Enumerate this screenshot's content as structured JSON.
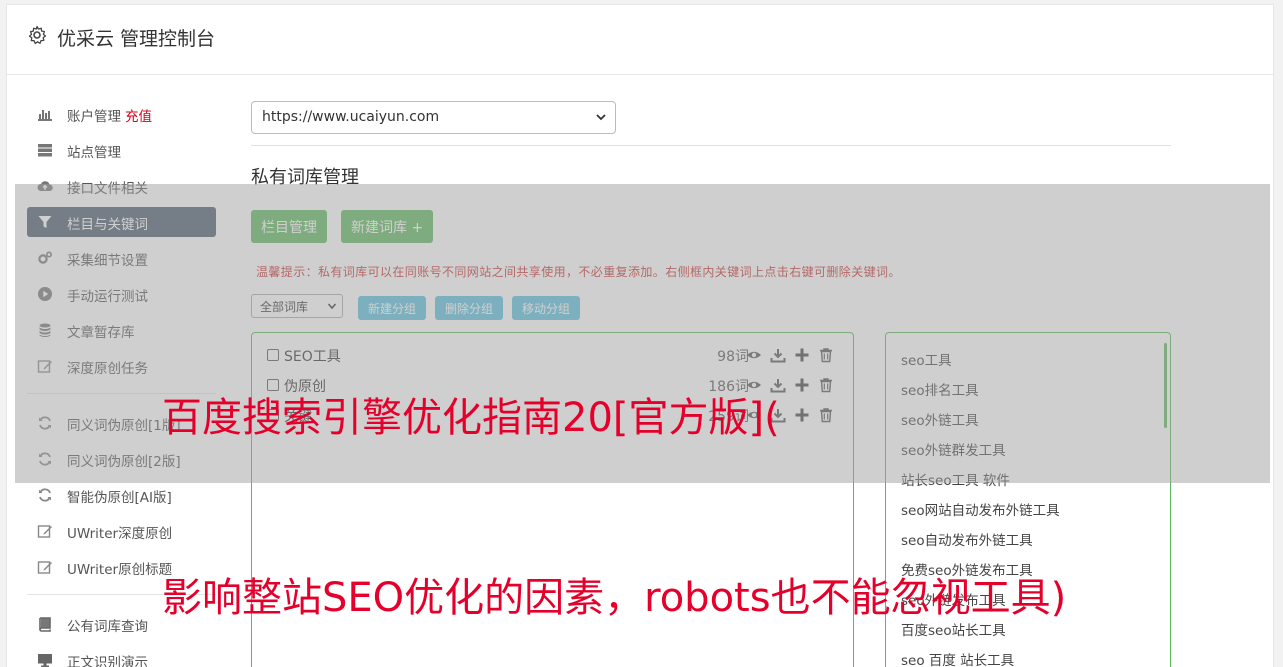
{
  "header": {
    "title": "优采云 管理控制台"
  },
  "sidebar": {
    "items": [
      {
        "label": "账户管理",
        "badge": "充值",
        "icon": "bar-chart-icon"
      },
      {
        "label": "站点管理",
        "icon": "server-icon"
      },
      {
        "label": "接口文件相关",
        "icon": "cloud-upload-icon"
      },
      {
        "label": "栏目与关键词",
        "icon": "filter-icon"
      },
      {
        "label": "采集细节设置",
        "icon": "cogs-icon"
      },
      {
        "label": "手动运行测试",
        "icon": "play-circle-icon"
      },
      {
        "label": "文章暂存库",
        "icon": "database-icon"
      },
      {
        "label": "深度原创任务",
        "icon": "edit-icon"
      },
      {
        "label": "同义词伪原创[1版]",
        "icon": "refresh-icon"
      },
      {
        "label": "同义词伪原创[2版]",
        "icon": "refresh-icon"
      },
      {
        "label": "智能伪原创[AI版]",
        "icon": "refresh-icon"
      },
      {
        "label": "UWriter深度原创",
        "icon": "edit-icon"
      },
      {
        "label": "UWriter原创标题",
        "icon": "edit-icon"
      },
      {
        "label": "公有词库查询",
        "icon": "book-icon"
      },
      {
        "label": "正文识别演示",
        "icon": "monitor-icon"
      }
    ]
  },
  "main": {
    "site_select": {
      "value": "https://www.ucaiyun.com"
    },
    "section_title": "私有词库管理",
    "buttons": {
      "column_manage": "栏目管理",
      "new_library": "新建词库 +"
    },
    "tip": "温馨提示：私有词库可以在同账号不同网站之间共享使用，不必重复添加。右侧框内关键词上点击右键可删除关键词。",
    "group_select": {
      "value": "全部词库"
    },
    "group_buttons": {
      "new_group": "新建分组",
      "delete_group": "删除分组",
      "move_group": "移动分组"
    },
    "libraries": [
      {
        "name": "SEO工具",
        "count": "98词"
      },
      {
        "name": "伪原创",
        "count": "186词"
      },
      {
        "name": "关键",
        "count": "259词"
      }
    ],
    "keywords": [
      "seo工具",
      "seo排名工具",
      "seo外链工具",
      "seo外链群发工具",
      "站长seo工具 软件",
      "seo网站自动发布外链工具",
      "seo自动发布外链工具",
      "免费seo外链发布工具",
      "seo外链发布工具",
      "百度seo站长工具",
      "seo 百度 站长工具"
    ]
  },
  "overlay": {
    "line1": "百度搜索引擎优化指南20[官方版](",
    "line2": "影响整站SEO优化的因素，robots也不能忽视工具)"
  },
  "colors": {
    "accent_green": "#5cb85c",
    "accent_blue": "#5bc0de",
    "nav_active": "#4b5a6e",
    "tip_red": "#c9302c",
    "overlay_red": "#e4002b"
  }
}
